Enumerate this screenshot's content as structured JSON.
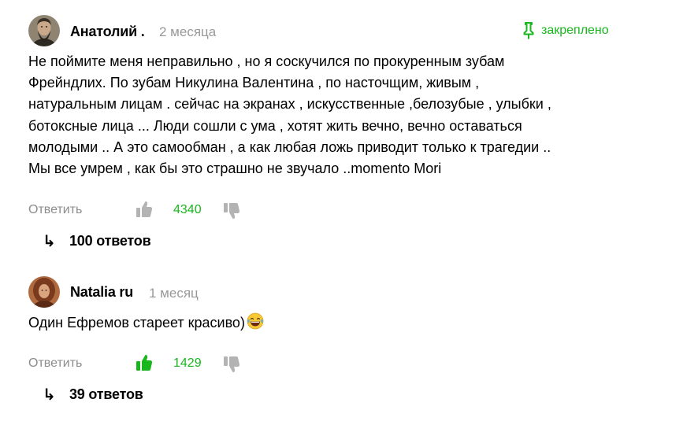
{
  "comments": [
    {
      "author": "Анатолий .",
      "time": "2 месяца",
      "pinned_label": "закреплено",
      "text_lines": [
        "Не поймите меня неправильно , но я соскучился по прокуренным зубам",
        "Фрейндлих. По зубам Никулина Валентина , по насточщим, живым ,",
        "натуральным лицам . сейчас на экранах , искусственные ,белозубые , улыбки ,",
        "ботоксные лица ... Люди сошли с ума , хотят жить вечно, вечно оставаться",
        "молодыми .. А это самообман , а как любая ложь приводит только к трагедии ..",
        "Мы все умрем , как бы это страшно не звучало ..momento Mori"
      ],
      "reply_label": "Ответить",
      "likes": "4340",
      "liked": false,
      "replies_arrow": "↳",
      "replies_label": "100 ответов"
    },
    {
      "author": "Natalia ru",
      "time": "1 месяц",
      "text": "Один Ефремов стареет красиво)",
      "emoji": "face-with-tears-of-joy-icon",
      "reply_label": "Ответить",
      "likes": "1429",
      "liked": true,
      "replies_arrow": "↳",
      "replies_label": "39 ответов"
    }
  ],
  "colors": {
    "accent_green": "#18b71d",
    "muted_gray": "#8c8c8c",
    "time_gray": "#999999",
    "icon_gray": "#b3b3b3",
    "text": "#000000"
  },
  "icons": {
    "pin": "pin-icon",
    "like": "thumbs-up-icon",
    "dislike": "thumbs-down-icon",
    "replies": "reply-arrow-icon"
  }
}
